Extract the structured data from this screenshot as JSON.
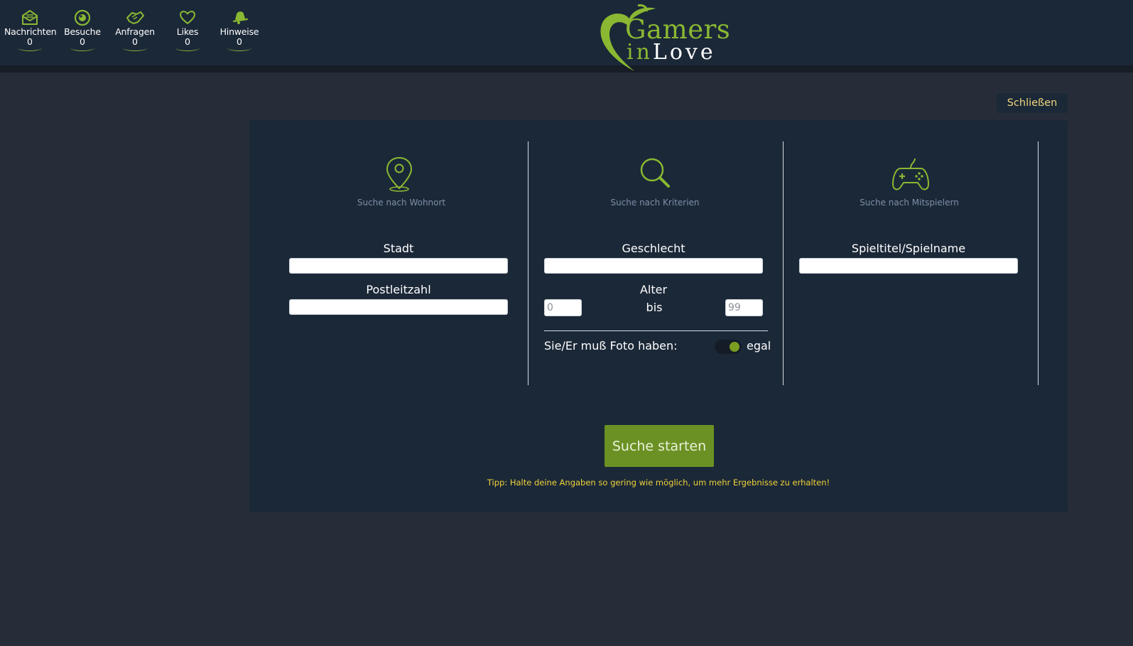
{
  "colors": {
    "accent": "#8ab832",
    "header_bg": "#1b2838",
    "page_bg": "#262d38",
    "button_bg": "#6b9124",
    "close_text": "#f0d57a",
    "tip_text": "#f0d23a"
  },
  "nav": {
    "items": [
      {
        "label": "Nachrichten",
        "count": "0",
        "icon": "envelope-icon"
      },
      {
        "label": "Besuche",
        "count": "0",
        "icon": "eye-icon"
      },
      {
        "label": "Anfragen",
        "count": "0",
        "icon": "handshake-icon"
      },
      {
        "label": "Likes",
        "count": "0",
        "icon": "heart-icon"
      },
      {
        "label": "Hinweise",
        "count": "0",
        "icon": "bell-icon"
      }
    ]
  },
  "logo": {
    "line1": "Gamers",
    "line2a": "in",
    "line2b": "Love"
  },
  "close_label": "Schließen",
  "columns": {
    "location": {
      "icon": "location-pin-icon",
      "caption": "Suche nach Wohnort",
      "city_label": "Stadt",
      "city_value": "",
      "zip_label": "Postleitzahl",
      "zip_value": ""
    },
    "criteria": {
      "icon": "magnifier-icon",
      "caption": "Suche nach Kriterien",
      "gender_label": "Geschlecht",
      "gender_value": "",
      "age_label": "Alter",
      "age_from": "0",
      "age_sep": "bis",
      "age_to": "99",
      "photo_label": "Sie/Er muß Foto haben:",
      "photo_value": "egal"
    },
    "players": {
      "icon": "gamepad-icon",
      "caption": "Suche nach Mitspielern",
      "game_label": "Spieltitel/Spielname",
      "game_value": ""
    }
  },
  "search_button": "Suche starten",
  "tip": "Tipp: Halte deine Angaben so gering wie möglich, um mehr Ergebnisse zu erhalten!"
}
